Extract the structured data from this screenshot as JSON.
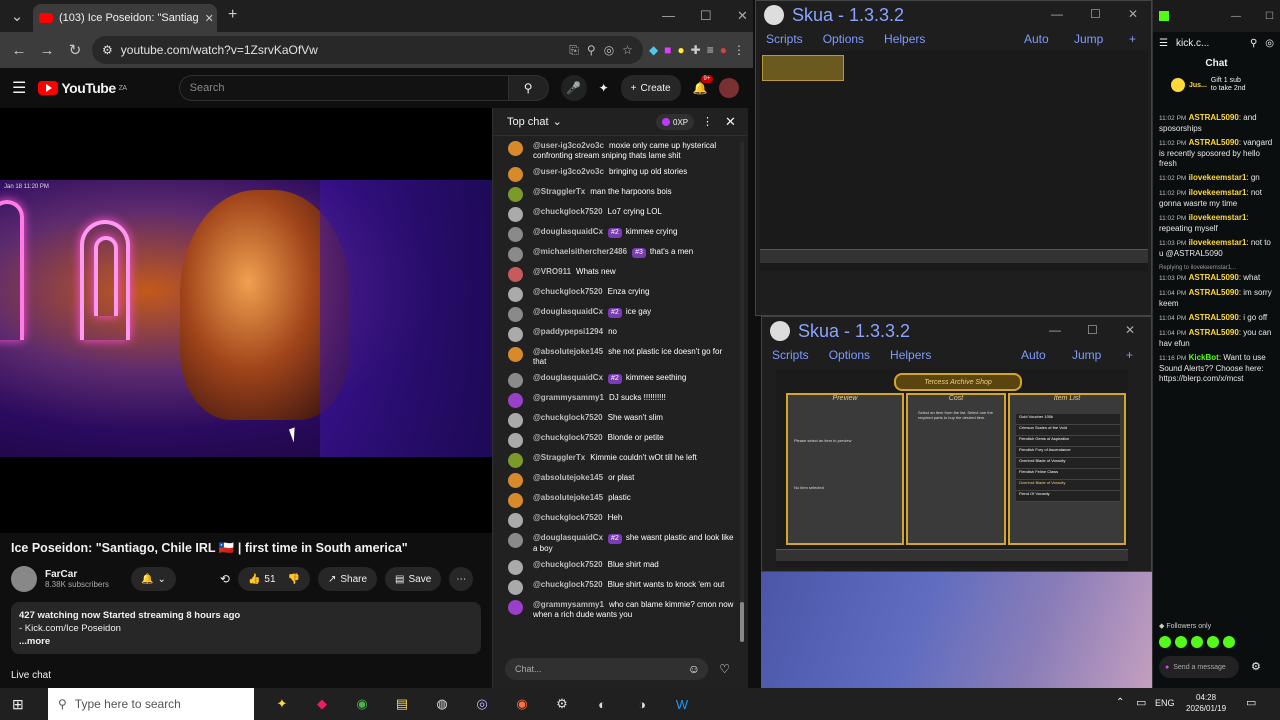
{
  "browser": {
    "tab_title": "(103) Ice Poseidon: \"Santiag",
    "url": "youtube.com/watch?v=1ZsrvKaOfVw"
  },
  "youtube": {
    "country": "ZA",
    "logo_text": "YouTube",
    "search_placeholder": "Search",
    "create_label": "Create",
    "notif_count": "9+",
    "video_timestamp": "Jan 18 11:20 PM",
    "video_title": "Ice Poseidon: \"Santiago, Chile IRL 🇨🇱 | first time in South america\"",
    "channel_name": "FarCar",
    "subscribers": "8.38K subscribers",
    "likes": "51",
    "share_label": "Share",
    "save_label": "Save",
    "description": [
      "427 watching now  Started streaming 8 hours ago",
      "- Kick.com/Ice Poseidon",
      "...more"
    ],
    "live_chat_label": "Live chat"
  },
  "chat": {
    "mode": "Top chat",
    "xp_label": "0XP",
    "input_placeholder": "Chat...",
    "messages": [
      {
        "author": "@user-ig3co2vo3c",
        "badge": "",
        "text": "moxie only came up hysterical confronting stream sniping thats lame shit",
        "color": "#d88a2b"
      },
      {
        "author": "@user-ig3co2vo3c",
        "badge": "",
        "text": "bringing up old stories",
        "color": "#d88a2b"
      },
      {
        "author": "@StragglerTx",
        "badge": "",
        "text": "man the harpoons bois",
        "color": "#7a9a2a"
      },
      {
        "author": "@chuckglock7520",
        "badge": "",
        "text": "Lo7 crying LOL",
        "color": "#aaaaaa"
      },
      {
        "author": "@douglasquaidCx",
        "badge": "#2",
        "text": "kimmee crying",
        "color": "#8a8a8a"
      },
      {
        "author": "@michaelsithercher2486",
        "badge": "#3",
        "text": "that's a men",
        "color": "#8a8a8a"
      },
      {
        "author": "@VRO911",
        "badge": "",
        "text": "Whats new",
        "color": "#c75a5a"
      },
      {
        "author": "@chuckglock7520",
        "badge": "",
        "text": "Enza crying",
        "color": "#aaaaaa"
      },
      {
        "author": "@douglasquaidCx",
        "badge": "#2",
        "text": "ice gay",
        "color": "#8a8a8a"
      },
      {
        "author": "@paddypepsi1294",
        "badge": "",
        "text": "no",
        "color": "#aaaaaa"
      },
      {
        "author": "@absolutejoke145",
        "badge": "",
        "text": "she not plastic ice doesn't go for that",
        "color": "#d88a2b"
      },
      {
        "author": "@douglasquaidCx",
        "badge": "#2",
        "text": "kimmee seething",
        "color": "#8a8a8a"
      },
      {
        "author": "@grammysammy1",
        "badge": "",
        "text": "DJ sucks !!!!!!!!!!",
        "color": "#9a3fc9"
      },
      {
        "author": "@chuckglock7520",
        "badge": "",
        "text": "She wasn't slim",
        "color": "#aaaaaa"
      },
      {
        "author": "@chuckglock7520",
        "badge": "",
        "text": "Blonde or petite",
        "color": "#aaaaaa"
      },
      {
        "author": "@StragglerTx",
        "badge": "",
        "text": "Kimmie couldn't wOt till he left",
        "color": "#7a9a2a"
      },
      {
        "author": "@absolutejoke145",
        "badge": "",
        "text": "or plast",
        "color": "#d88a2b"
      },
      {
        "author": "@absolutejoke145",
        "badge": "",
        "text": "plastic",
        "color": "#d88a2b"
      },
      {
        "author": "@chuckglock7520",
        "badge": "",
        "text": "Heh",
        "color": "#aaaaaa"
      },
      {
        "author": "@douglasquaidCx",
        "badge": "#2",
        "text": "she wasnt plastic and look like a boy",
        "color": "#8a8a8a"
      },
      {
        "author": "@chuckglock7520",
        "badge": "",
        "text": "Blue shirt mad",
        "color": "#aaaaaa"
      },
      {
        "author": "@chuckglock7520",
        "badge": "",
        "text": "Blue shirt wants to knock 'em out",
        "color": "#aaaaaa"
      },
      {
        "author": "@grammysammy1",
        "badge": "",
        "text": "who can blame kimmie? cmon now when a rich dude wants you",
        "color": "#9a3fc9"
      }
    ]
  },
  "skua1": {
    "title": "Skua - 1.3.3.2",
    "menu": [
      "Scripts",
      "Options",
      "Helpers"
    ],
    "right": [
      "Auto",
      "Jump",
      "+"
    ]
  },
  "skua2": {
    "title": "Skua - 1.3.3.2",
    "menu": [
      "Scripts",
      "Options",
      "Helpers"
    ],
    "right": [
      "Auto",
      "Jump",
      "+"
    ],
    "shop_title": "Tercess Archive Shop",
    "panels": [
      "Preview",
      "Cost",
      "Item List"
    ],
    "preview_hint": "Please select an item to preview",
    "no_item": "No item selected",
    "cost_hint": "Select an item from the list. Select one the required parts to buy the desired item.",
    "items": [
      "Gold Voucher 100k",
      "Crimson Scales of the Void",
      "Fiendish Gems of Aspiration",
      "Fiendish Fury of Ascendance",
      "Overlord Blade of Voracity",
      "Fiendish Feline Claws",
      "Overlord Blade of Voracity",
      "Fiend Of Voracity"
    ]
  },
  "kick": {
    "tab": "kick.c...",
    "header": "Chat",
    "gift_user": "Jus...",
    "gift_text": "Gift 1 sub to take 2nd",
    "messages": [
      {
        "time": "11:02 PM",
        "user": "ASTRAL5090",
        "text": "and sposorships",
        "green": false
      },
      {
        "time": "11:02 PM",
        "user": "ASTRAL5090",
        "text": "vangard is recently sposored by hello fresh",
        "green": false
      },
      {
        "time": "11:02 PM",
        "user": "ilovekeemstar1",
        "text": "gn",
        "green": false
      },
      {
        "time": "11:02 PM",
        "user": "ilovekeemstar1",
        "text": "not gonna wasrte my time",
        "green": false
      },
      {
        "time": "11:02 PM",
        "user": "ilovekeemstar1",
        "text": "repeating myself",
        "green": false
      },
      {
        "time": "11:03 PM",
        "user": "ilovekeemstar1",
        "text": "not to u @ASTRAL5090",
        "green": false
      },
      {
        "time": "11:03 PM",
        "user": "ASTRAL5090",
        "text": "what",
        "green": false,
        "reply": "Replying to ilovekeemstar1..."
      },
      {
        "time": "11:04 PM",
        "user": "ASTRAL5090",
        "text": "im sorry keem",
        "green": false
      },
      {
        "time": "11:04 PM",
        "user": "ASTRAL5090",
        "text": "i go off",
        "green": false
      },
      {
        "time": "11:04 PM",
        "user": "ASTRAL5090",
        "text": "you can hav efun",
        "green": false
      },
      {
        "time": "11:16 PM",
        "user": "KickBot",
        "text": "Want to use Sound Alerts?? Choose here: https://blerp.com/x/mcst",
        "green": true
      }
    ],
    "followers_label": "Followers only",
    "send_label": "Send a message"
  },
  "taskbar": {
    "search_placeholder": "Type here to search",
    "lang": "ENG",
    "time": "04:28",
    "date": "2026/01/19"
  }
}
